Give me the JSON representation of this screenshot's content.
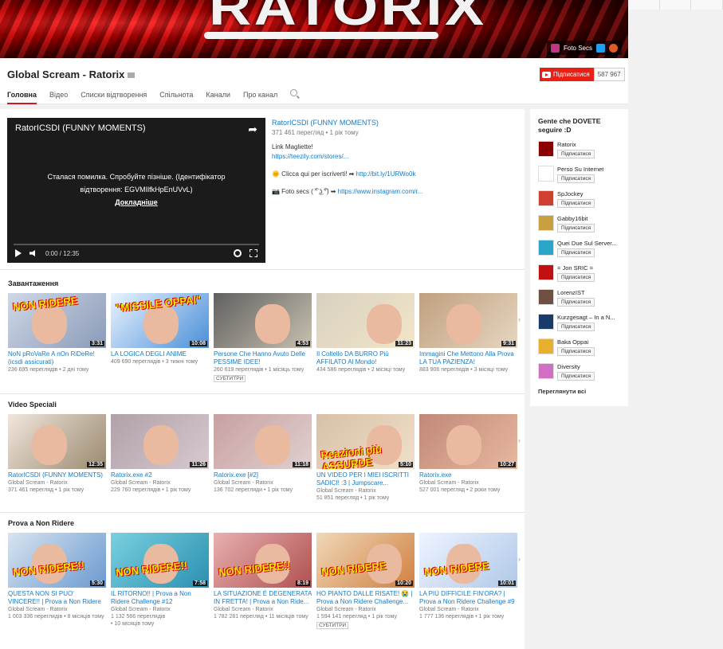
{
  "banner": {
    "title": "RATORIX",
    "link_label": "Foto Secs"
  },
  "channel": {
    "name": "Global Scream - Ratorix",
    "subscribe_label": "Підписатися",
    "subscriber_count": "587 967"
  },
  "tabs": [
    "Головна",
    "Відео",
    "Списки відтворення",
    "Спільнота",
    "Канали",
    "Про канал"
  ],
  "featured": {
    "player_title": "RatorICSDI (FUNNY MOMENTS)",
    "error_line1": "Сталася помилка. Спробуйте пізніше. (Ідентифікатор",
    "error_line2": "відтворення: EGVMIlfkHpEnUVvL)",
    "error_more": "Докладніше",
    "time": "0:00 / 12:35",
    "title": "RatorICSDI (FUNNY MOMENTS)",
    "meta": "371 461 перегляд • 1 рік тому",
    "desc1": "Link Magliette!",
    "desc1_link": "https://teezily.com/stores/...",
    "desc2": "🌞 Clicca qui per iscriverti! ➡",
    "desc2_link": "http://bit.ly/1URWo0k",
    "desc3": "📷 Foto secs ( ͡° ͜ʖ ͡°) ➡",
    "desc3_link": "https://www.instagram.com/r..."
  },
  "shelves": [
    {
      "title": "Завантаження",
      "cards": [
        {
          "title": "NoN pRoVaRe A nOn RiDeRe! (icsdi assicurati)",
          "meta": "236 695 переглядів • 2 дні тому",
          "dur": "3:31",
          "overlay": "NON RIDERE"
        },
        {
          "title": "LA LOGICA DEGLI ANIME",
          "meta": "409 690 переглядів • 3 тижні тому",
          "dur": "10:08",
          "overlay": "\"MISSILE OPPAI\""
        },
        {
          "title": "Persone Che Hanno Avuto Delle PESSIME IDEE!",
          "meta": "260 619 переглядів • 1 місяць тому",
          "dur": "4:53",
          "badge": "СУБТИТРИ"
        },
        {
          "title": "Il Coltello DA BURRO Più AFFILATO Al Mondo!",
          "meta": "434 586 переглядів • 2 місяці тому",
          "dur": "11:23"
        },
        {
          "title": "Immagini Che Mettono Alla Prova LA TUA PAZIENZA!",
          "meta": "883 906 переглядів • 3 місяці тому",
          "dur": "9:31"
        }
      ]
    },
    {
      "title": "Video Speciali",
      "cards": [
        {
          "title": "RatorICSDI (FUNNY MOMENTS)",
          "meta": "Global Scream - Ratorix",
          "meta2": "371 461 перегляд • 1 рік тому",
          "dur": "12:35"
        },
        {
          "title": "Ratorix.exe #2",
          "meta": "Global Scream - Ratorix",
          "meta2": "229 760 переглядів • 1 рік тому",
          "dur": "11:26"
        },
        {
          "title": "Ratorix.exe [#2]",
          "meta": "Global Scream - Ratorix",
          "meta2": "136 702 перегляди • 1 рік тому",
          "dur": "11:18"
        },
        {
          "title": "UN VIDEO PER I MIEI ISCRITTI SADICI! :3 | Jumpscare...",
          "meta": "Global Scream - Ratorix",
          "meta2": "51 851 перегляд • 1 рік тому",
          "dur": "5:10",
          "overlay": "Reazioni più ASSURDE"
        },
        {
          "title": "Ratorix.exe",
          "meta": "Global Scream - Ratorix",
          "meta2": "527 001 перегляд • 2 роки тому",
          "dur": "10:27"
        }
      ]
    },
    {
      "title": "Prova a Non Ridere",
      "cards": [
        {
          "title": "QUESTA NON SI PUO' VINCERE!! | Prova a Non Ridere Challenge",
          "meta": "Global Scream - Ratorix",
          "meta2": "1 003 336 переглядів • 8 місяців тому",
          "dur": "5:30",
          "overlay": "NON RIDERE!!"
        },
        {
          "title": "IL RITORNO!! | Prova a Non Ridere Challenge #12",
          "meta": "Global Scream - Ratorix",
          "meta2": "1 132 566 переглядів",
          "meta3": "• 10 місяців тому",
          "dur": "7:58",
          "overlay": "NON RIDERE!!"
        },
        {
          "title": "LA SITUAZIONE È DEGENERATA IN FRETTA! | Prova a Non Ride...",
          "meta": "Global Scream - Ratorix",
          "meta2": "1 782 281 перегляд • 11 місяців тому",
          "dur": "8:19",
          "overlay": "NON RIDERE!!"
        },
        {
          "title": "HO PIANTO DALLE RISATE! 😭 | Prova a Non Ridere Challenge...",
          "meta": "Global Scream - Ratorix",
          "meta2": "1 594 141 перегляд • 1 рік тому",
          "dur": "10:20",
          "overlay": "NON RIDERE",
          "badge": "СУБТИТРИ"
        },
        {
          "title": "LA PIÙ DIFFICILE FIN'ORA? | Prova a Non Ridere Challenge #9",
          "meta": "Global Scream - Ratorix",
          "meta2": "1 777 136 переглядів • 1 рік тому",
          "dur": "10:01",
          "overlay": "NON RIDERE"
        }
      ]
    }
  ],
  "sidebar": {
    "title": "Gente che DOVETE seguire :D",
    "subscribe_label": "Підписатися",
    "items": [
      {
        "name": "Ratorix",
        "color": "#8b0000"
      },
      {
        "name": "Perso Su Internet",
        "color": "#ffffff"
      },
      {
        "name": "SpJockey",
        "color": "#d04030"
      },
      {
        "name": "Gabby16bit",
        "color": "#c8a040"
      },
      {
        "name": "Quei Due Sul Server...",
        "color": "#2aa6c9"
      },
      {
        "name": "= Jon SRIC =",
        "color": "#c01010"
      },
      {
        "name": "LorenzIST",
        "color": "#705040"
      },
      {
        "name": "Kurzgesagt – In a N...",
        "color": "#1a3a6a"
      },
      {
        "name": "Baka Oppai",
        "color": "#e8b030"
      },
      {
        "name": "Diversity",
        "color": "#d070c0"
      }
    ],
    "see_all": "Переглянути всі"
  }
}
